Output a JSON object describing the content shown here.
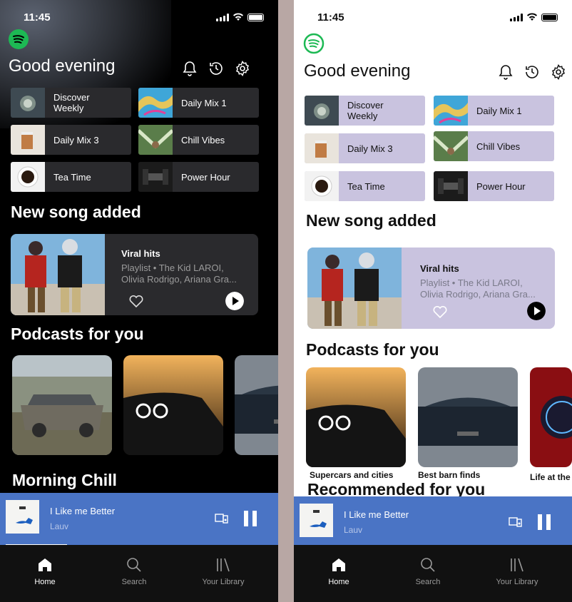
{
  "status": {
    "time": "11:45"
  },
  "header": {
    "greeting": "Good evening"
  },
  "quick_tiles_dark": [
    {
      "label": "Discover\nWeekly",
      "thumb": "glass"
    },
    {
      "label": "Daily Mix 1",
      "thumb": "marble"
    },
    {
      "label": "Daily Mix 3",
      "thumb": "tea"
    },
    {
      "label": "Chill Vibes",
      "thumb": "hammock"
    },
    {
      "label": "Tea Time",
      "thumb": "cup"
    },
    {
      "label": "Power Hour",
      "thumb": "dumbbell"
    }
  ],
  "quick_tiles_light": [
    {
      "label": "Discover\nWeekly",
      "thumb": "glass"
    },
    {
      "label": "Daily Mix 1",
      "thumb": "marble"
    },
    {
      "label": "Daily Mix 3",
      "thumb": "tea"
    },
    {
      "label": "Chill Vibes",
      "thumb": "hammock"
    },
    {
      "label": "Tea Time",
      "thumb": "cup"
    },
    {
      "label": "Power Hour",
      "thumb": "dumbbell"
    }
  ],
  "new_song": {
    "heading": "New song added",
    "title": "Viral hits",
    "subtitle": "Playlist • The Kid LAROI, Olivia Rodrigo, Ariana Gra..."
  },
  "podcasts": {
    "heading": "Podcasts for you",
    "light_labels": [
      "Supercars and cities",
      "Best barn finds",
      "Life at the"
    ]
  },
  "next_section_dark": "Morning Chill",
  "next_section_light": "Recommended for you",
  "player": {
    "song": "I Like me Better",
    "artist": "Lauv",
    "progress": 0.22
  },
  "nav": [
    {
      "label": "Home",
      "icon": "home-icon"
    },
    {
      "label": "Search",
      "icon": "search-icon"
    },
    {
      "label": "Your Library",
      "icon": "library-icon"
    }
  ],
  "colors": {
    "accent": "#1DB954",
    "player": "#4a74c5",
    "tile_light": "#c9c3df",
    "tile_dark": "#2a2a2d"
  }
}
